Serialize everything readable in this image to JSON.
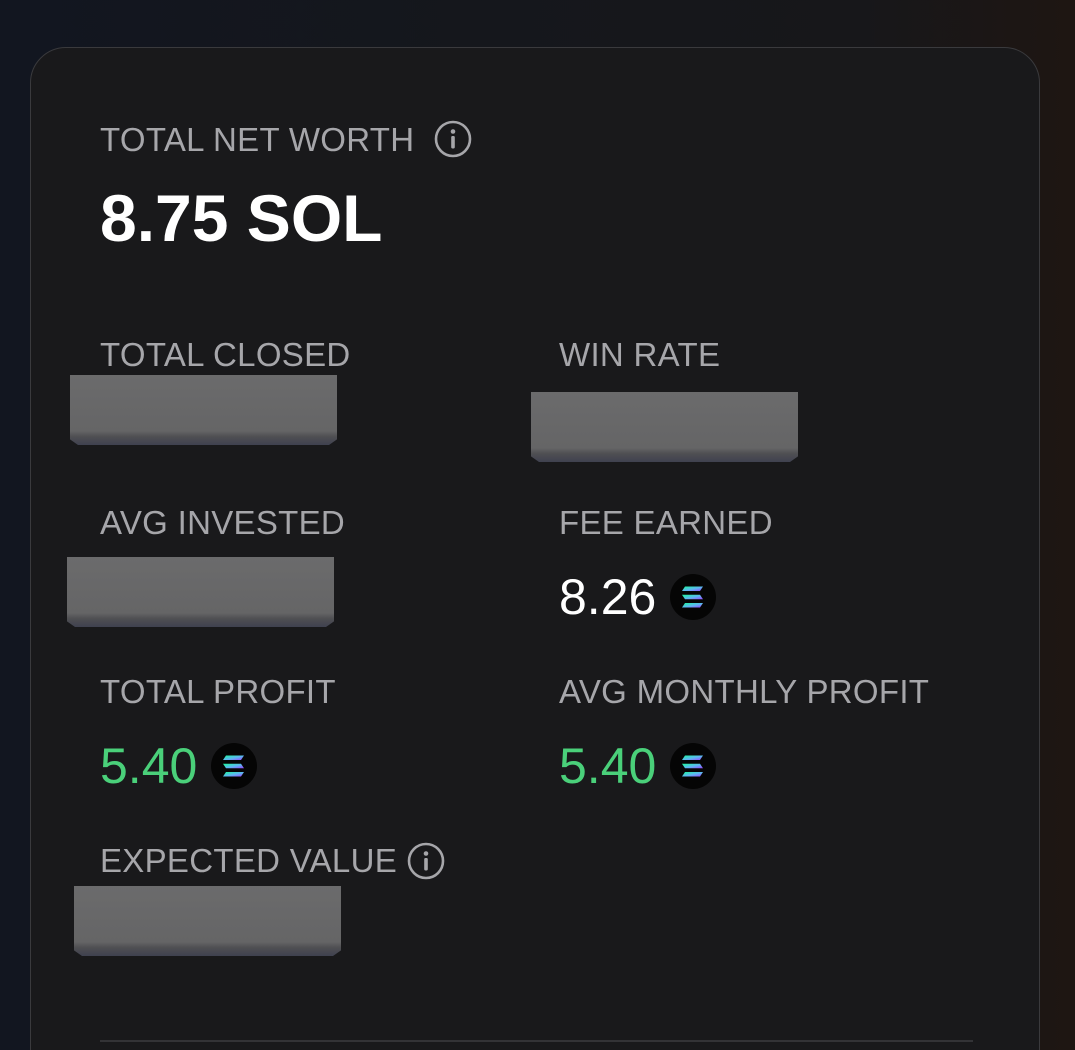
{
  "net_worth": {
    "label": "TOTAL NET WORTH",
    "value": "8.75 SOL",
    "info_icon": "info-icon"
  },
  "stats": {
    "total_closed": {
      "label": "TOTAL CLOSED",
      "redacted": true
    },
    "win_rate": {
      "label": "WIN RATE",
      "redacted": true
    },
    "avg_invested": {
      "label": "AVG INVESTED",
      "redacted": true
    },
    "fee_earned": {
      "label": "FEE EARNED",
      "value": "8.26",
      "icon": "solana-icon"
    },
    "total_profit": {
      "label": "TOTAL PROFIT",
      "value": "5.40",
      "icon": "solana-icon"
    },
    "avg_monthly_profit": {
      "label": "AVG MONTHLY PROFIT",
      "value": "5.40",
      "icon": "solana-icon"
    },
    "expected_value": {
      "label": "EXPECTED VALUE",
      "redacted": true,
      "info_icon": "info-icon"
    }
  },
  "colors": {
    "background": "#17171a",
    "card": "#19191b",
    "label": "#a6a6aa",
    "value": "#ffffff",
    "profit": "#4ad07a"
  }
}
